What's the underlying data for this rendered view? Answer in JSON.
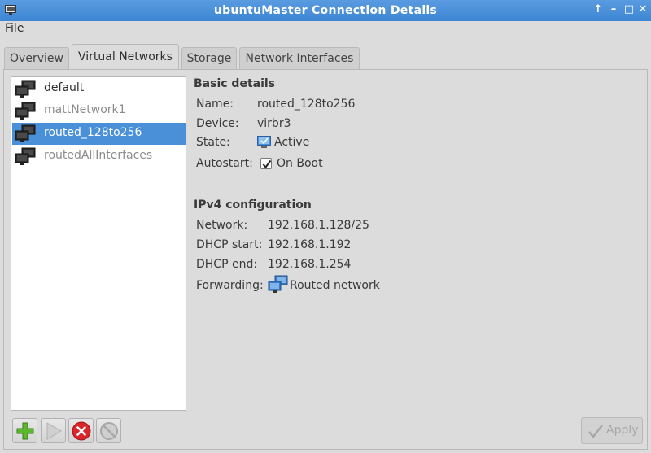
{
  "window": {
    "title": "ubuntuMaster Connection Details",
    "controls": [
      "↑",
      "–",
      "□",
      "✕"
    ]
  },
  "menubar": {
    "file": "File"
  },
  "tabs": [
    {
      "label": "Overview",
      "active": false
    },
    {
      "label": "Virtual Networks",
      "active": true
    },
    {
      "label": "Storage",
      "active": false
    },
    {
      "label": "Network Interfaces",
      "active": false
    }
  ],
  "networks": [
    {
      "name": "default",
      "state": "active",
      "selected": false
    },
    {
      "name": "mattNetwork1",
      "state": "inactive",
      "selected": false
    },
    {
      "name": "routed_128to256",
      "state": "active",
      "selected": true
    },
    {
      "name": "routedAllInterfaces",
      "state": "inactive",
      "selected": false
    }
  ],
  "basic": {
    "title": "Basic details",
    "name_label": "Name:",
    "name_value": "routed_128to256",
    "device_label": "Device:",
    "device_value": "virbr3",
    "state_label": "State:",
    "state_value": "Active",
    "autostart_label": "Autostart:",
    "autostart_value": "On Boot",
    "autostart_checked": true
  },
  "ipv4": {
    "title": "IPv4 configuration",
    "network_label": "Network:",
    "network_value": "192.168.1.128/25",
    "dhcp_start_label": "DHCP start:",
    "dhcp_start_value": "192.168.1.192",
    "dhcp_end_label": "DHCP end:",
    "dhcp_end_value": "192.168.1.254",
    "forwarding_label": "Forwarding:",
    "forwarding_value": "Routed network"
  },
  "toolbar": {
    "add_icon": "plus-icon",
    "start_icon": "play-icon",
    "stop_icon": "stop-icon",
    "delete_icon": "no-entry-icon"
  },
  "apply": {
    "label": "Apply"
  },
  "colors": {
    "titlebar": "#4a90d9",
    "selection": "#4a90d9",
    "add_green": "#5cb82e",
    "stop_red": "#d9262b"
  }
}
